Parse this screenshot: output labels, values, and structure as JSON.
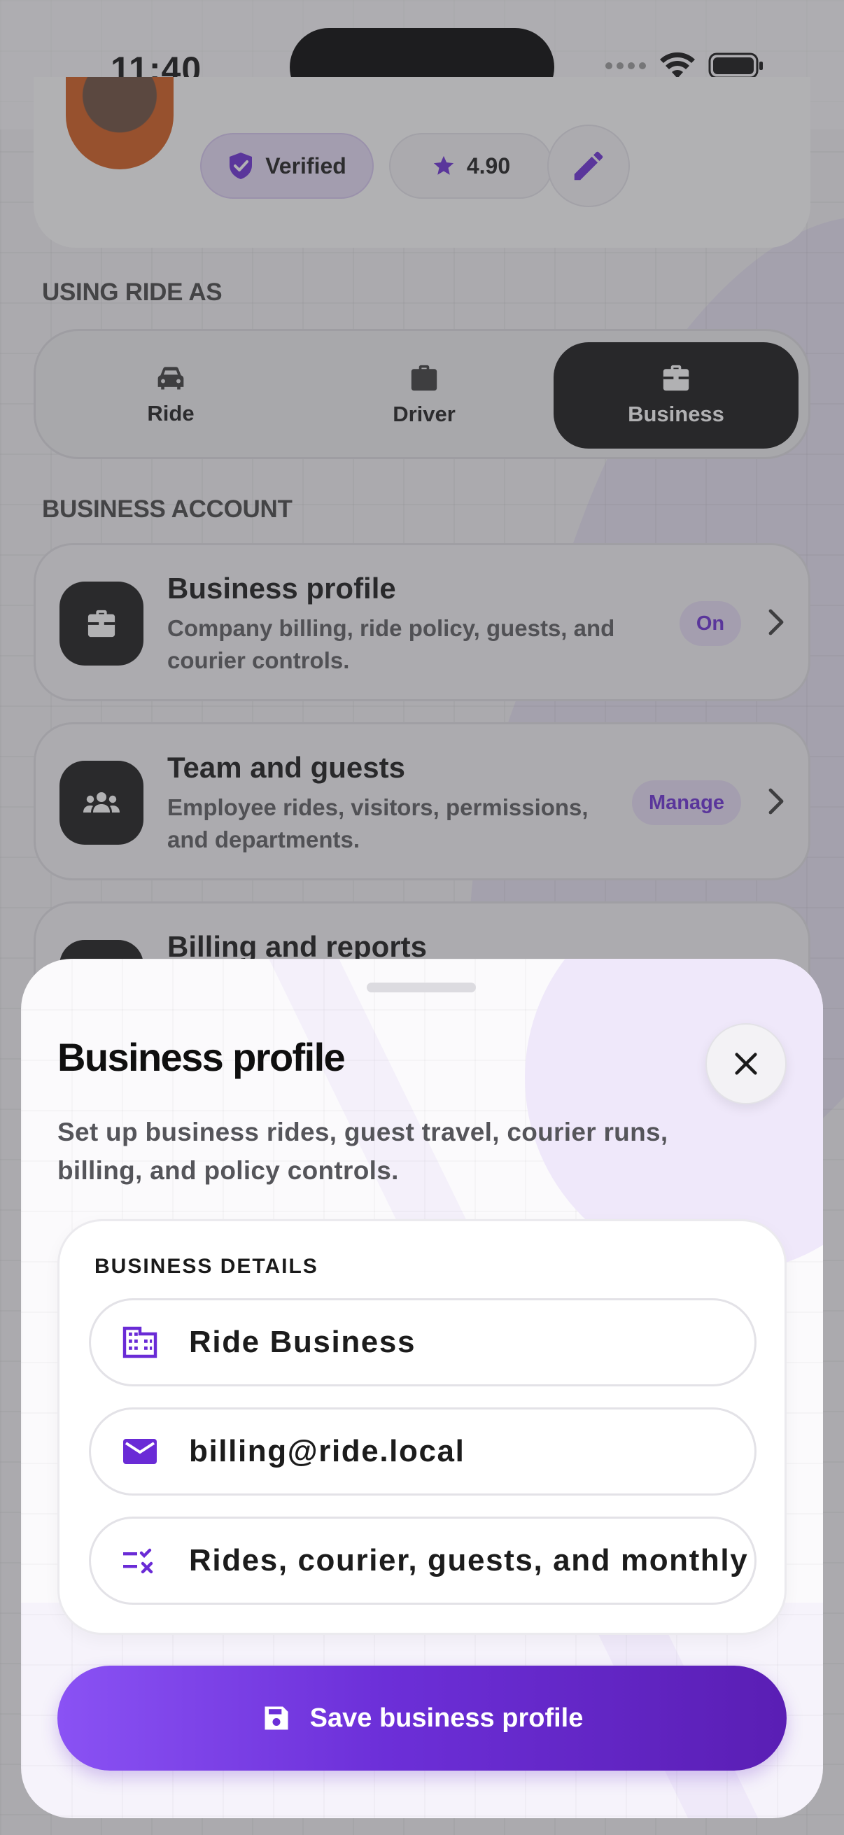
{
  "status_bar": {
    "time": "11:40"
  },
  "profile": {
    "verified_label": "Verified",
    "rating": "4.90"
  },
  "using_ride_as": {
    "heading": "USING RIDE AS",
    "modes": [
      {
        "label": "Ride",
        "icon": "car-icon",
        "active": false
      },
      {
        "label": "Driver",
        "icon": "briefcase-icon",
        "active": false
      },
      {
        "label": "Business",
        "icon": "business-case-icon",
        "active": true
      }
    ]
  },
  "business_account": {
    "heading": "BUSINESS ACCOUNT",
    "rows": [
      {
        "title": "Business profile",
        "subtitle": "Company billing, ride policy, guests, and courier controls.",
        "badge": "On",
        "icon": "business-case-icon"
      },
      {
        "title": "Team and guests",
        "subtitle": "Employee rides, visitors, permissions, and departments.",
        "badge": "Manage",
        "icon": "group-icon"
      },
      {
        "title": "Billing and reports",
        "subtitle": "",
        "badge": "",
        "icon": "receipt-icon"
      }
    ]
  },
  "sheet": {
    "title": "Business profile",
    "description": "Set up business rides, guest travel, courier runs, billing, and policy controls.",
    "details_label": "BUSINESS DETAILS",
    "fields": [
      {
        "icon": "building-icon",
        "value": "Ride Business"
      },
      {
        "icon": "mail-icon",
        "value": "billing@ride.local"
      },
      {
        "icon": "policy-checklist-icon",
        "value": "Rides, courier, guests, and monthly billing"
      }
    ],
    "save_label": "Save business profile"
  },
  "colors": {
    "accent": "#6c2fd8",
    "accent_light": "#e9dff9",
    "dark": "#141414"
  }
}
